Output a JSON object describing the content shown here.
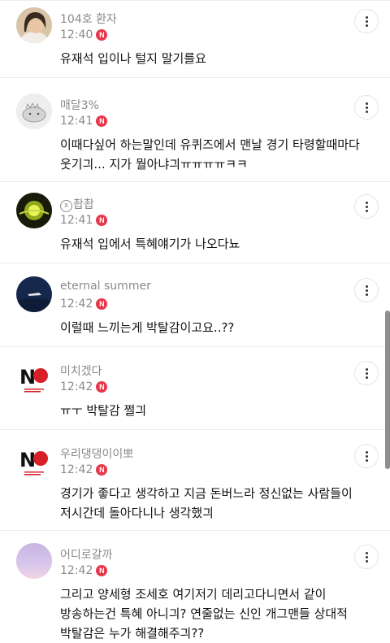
{
  "comments": [
    {
      "nickname": "104호 환자",
      "time": "12:40",
      "badge": "N",
      "text": "유재석 입이나 털지 말기를요"
    },
    {
      "nickname": "매달3%",
      "time": "12:41",
      "badge": "N",
      "text": "이때다싶어 하는말인데 유퀴즈에서 맨날 경기 타령할때마다\n웃기긔... 지가 뭘아냐긔ㅠㅠㅠㅠㅋㅋ"
    },
    {
      "nickname_mark": "x",
      "nickname": "촵촵",
      "time": "12:41",
      "badge": "N",
      "text": "유재석 입에서 특혜얘기가 나오다뇨"
    },
    {
      "nickname": "eternal summer",
      "time": "12:42",
      "badge": "N",
      "text": "이럴때 느끼는게 박탈감이고요..??"
    },
    {
      "nickname": "미치겠다",
      "time": "12:42",
      "badge": "N",
      "text": "ㅠㅜ 박탈감 쩔긔"
    },
    {
      "nickname": "우리댕댕이이뽀",
      "time": "12:42",
      "badge": "N",
      "text": "경기가 좋다고 생각하고 지금 돈버느라 정신없는 사람들이\n저시간데 돌아다니나 생각했긔"
    },
    {
      "nickname": "어디로갈까",
      "time": "12:42",
      "badge": "N",
      "text": "그리고 양세형 조세호 여기저기 데리고다니면서 같이\n방송하는건 특혜 아니긔? 연줄없는 신인 개그맨들 상대적\n박탈감은 누가 해결해주긔??"
    }
  ]
}
